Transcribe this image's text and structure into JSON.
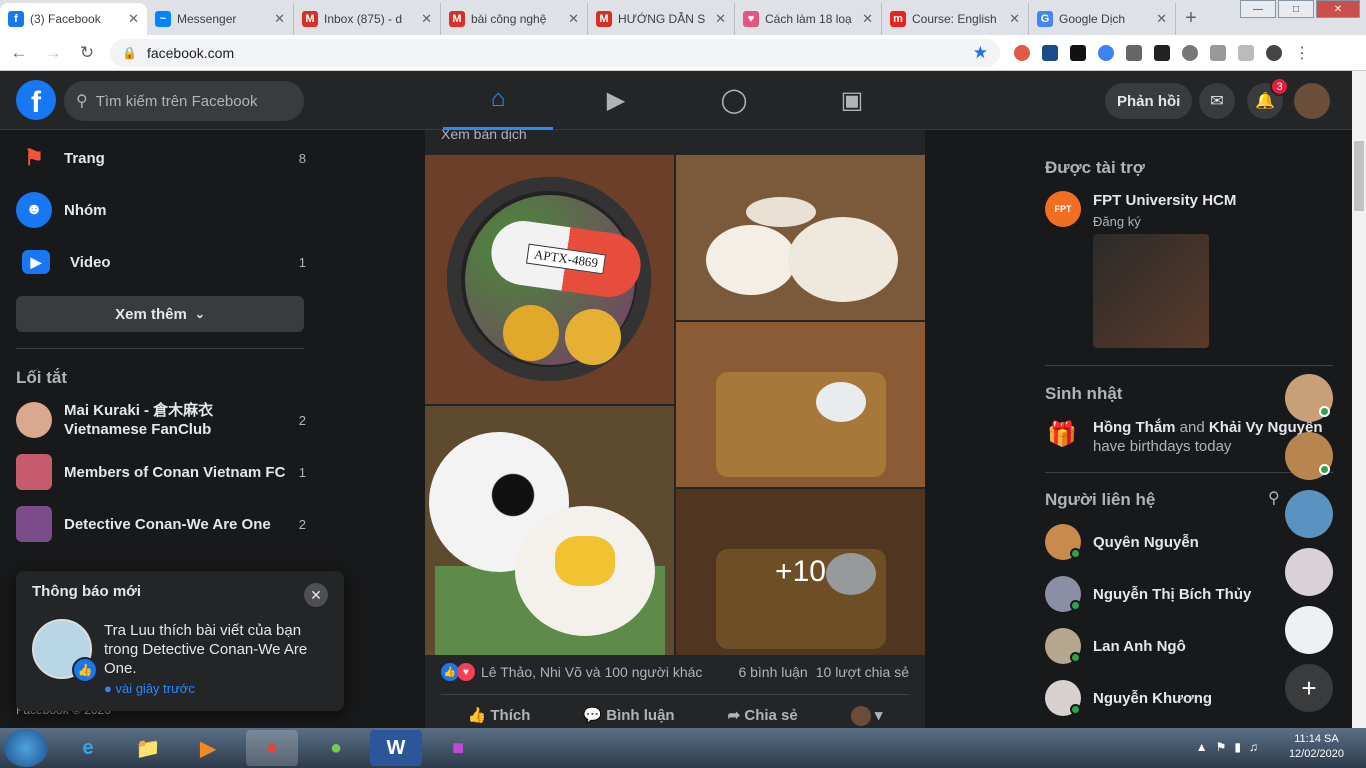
{
  "browser": {
    "tabs": [
      {
        "title": "(3) Facebook",
        "icon": "facebook-icon",
        "color": "#1877f2",
        "glyph": "f",
        "active": true
      },
      {
        "title": "Messenger",
        "icon": "messenger-icon",
        "color": "#0084ff",
        "glyph": "~"
      },
      {
        "title": "Inbox (875) - d",
        "icon": "gmail-icon",
        "color": "#d93025",
        "glyph": "M"
      },
      {
        "title": "bài công nghệ",
        "icon": "gmail-icon",
        "color": "#d93025",
        "glyph": "M"
      },
      {
        "title": "HƯỚNG DẪN S",
        "icon": "gmail-icon",
        "color": "#d93025",
        "glyph": "M"
      },
      {
        "title": "Cách làm 18 loạ",
        "icon": "heart-icon",
        "color": "#e75480",
        "glyph": "♥"
      },
      {
        "title": "Course: English",
        "icon": "moodle-icon",
        "color": "#e8231f",
        "glyph": "m"
      },
      {
        "title": "Google Dịch",
        "icon": "google-translate-icon",
        "color": "#4285f4",
        "glyph": "G"
      }
    ],
    "url": "facebook.com"
  },
  "header": {
    "search_placeholder": "Tìm kiếm trên Facebook",
    "feedback_label": "Phản hồi",
    "notifications_count": "3"
  },
  "sidebar": {
    "items": [
      {
        "label": "Trang",
        "count": "8",
        "icon": "flag-icon",
        "color": "#f5533d"
      },
      {
        "label": "Nhóm",
        "count": "",
        "icon": "groups-icon",
        "color": "#1877f2"
      },
      {
        "label": "Video",
        "count": "1",
        "icon": "video-icon",
        "color": "#1877f2"
      }
    ],
    "see_more_label": "Xem thêm",
    "shortcuts_title": "Lối tắt",
    "shortcuts": [
      {
        "label": "Mai Kuraki - 倉木麻衣 Vietnamese FanClub",
        "count": "2",
        "color": "#d9a88e"
      },
      {
        "label": "Members of Conan Vietnam FC",
        "count": "1",
        "color": "#c65b6b"
      },
      {
        "label": "Detective Conan-We Are One",
        "count": "2",
        "color": "#7a4d8a"
      }
    ],
    "footer_text": "Facebook © 2020"
  },
  "toast": {
    "title": "Thông báo mới",
    "message": "Tra Luu thích bài viết của bạn trong Detective Conan-We Are One.",
    "time": "vài giây trước"
  },
  "post": {
    "see_translation": "Xem bản dịch",
    "photos": [
      {
        "desc": "capsule-lunch-photo",
        "color": "#6b3f2a"
      },
      {
        "desc": "noodle-set-photo",
        "color": "#7a5a3a"
      },
      {
        "desc": "football-rice-photo",
        "color": "#5e4a2e"
      },
      {
        "desc": "basket-lunch-photo",
        "color": "#8a5b35"
      },
      {
        "desc": "sandwich-basket-photo",
        "color": "#7c5332"
      }
    ],
    "capsule_text": "APTX-4869",
    "more_photos": "+10",
    "reactions_text": "Lê Thảo, Nhi Võ và 100 người khác",
    "comments_text": "6 bình luận",
    "shares_text": "10 lượt chia sẻ",
    "actions": {
      "like": "Thích",
      "comment": "Bình luận",
      "share": "Chia sẻ"
    }
  },
  "right": {
    "sponsored_title": "Được tài trợ",
    "ad_name": "FPT University HCM",
    "ad_sub": "Đăng ký",
    "ad_logo": "FPT",
    "birthday_title": "Sinh nhật",
    "birthday_name1": "Hồng Thắm",
    "birthday_and": " and ",
    "birthday_name2": "Khải Vy Nguyễn",
    "birthday_sub": "have birthdays today",
    "contacts_title": "Người liên hệ",
    "contacts": [
      {
        "name": "Quyên Nguyễn",
        "color": "#c98a4d"
      },
      {
        "name": "Nguyễn Thị Bích Thủy",
        "color": "#8a8fa6"
      },
      {
        "name": "Lan Anh Ngô",
        "color": "#b5a68e"
      },
      {
        "name": "Nguyễn Khương",
        "color": "#d7d2cf"
      }
    ]
  },
  "taskbar": {
    "time": "11:14 SA",
    "date": "12/02/2020"
  }
}
